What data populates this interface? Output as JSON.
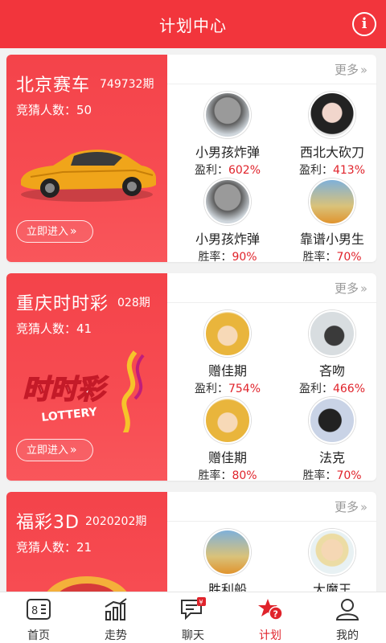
{
  "header": {
    "title": "计划中心",
    "info_symbol": "i"
  },
  "common": {
    "more_label": "更多",
    "enter_label": "立即进入"
  },
  "cards": [
    {
      "game": "北京赛车",
      "issue": "749732期",
      "guess_label": "竞猜人数：",
      "guess_count": "50",
      "users": [
        {
          "name": "小男孩炸弹",
          "stat_label": "盈利：",
          "stat_value": "602%"
        },
        {
          "name": "西北大砍刀",
          "stat_label": "盈利：",
          "stat_value": "413%"
        },
        {
          "name": "小男孩炸弹",
          "stat_label": "胜率：",
          "stat_value": "90%"
        },
        {
          "name": "靠谱小男生",
          "stat_label": "胜率：",
          "stat_value": "70%"
        }
      ]
    },
    {
      "game": "重庆时时彩",
      "issue": "028期",
      "guess_label": "竞猜人数：",
      "guess_count": "41",
      "logo_text": "时时彩",
      "logo_sub": "LOTTERY",
      "users": [
        {
          "name": "赠佳期",
          "stat_label": "盈利：",
          "stat_value": "754%"
        },
        {
          "name": "吝吻",
          "stat_label": "盈利：",
          "stat_value": "466%"
        },
        {
          "name": "赠佳期",
          "stat_label": "胜率：",
          "stat_value": "80%"
        },
        {
          "name": "法克",
          "stat_label": "胜率：",
          "stat_value": "70%"
        }
      ]
    },
    {
      "game": "福彩3D",
      "issue": "2020202期",
      "guess_label": "竞猜人数：",
      "guess_count": "21",
      "users": [
        {
          "name": "胜利船"
        },
        {
          "name": "大魔王"
        }
      ]
    }
  ],
  "nav": [
    {
      "label": "首页",
      "icon": "home-icon"
    },
    {
      "label": "走势",
      "icon": "trend-icon"
    },
    {
      "label": "聊天",
      "icon": "chat-icon",
      "badge": "¥"
    },
    {
      "label": "计划",
      "icon": "plan-icon",
      "active": true
    },
    {
      "label": "我的",
      "icon": "profile-icon"
    }
  ],
  "colors": {
    "brand_red": "#f2353c",
    "accent_red": "#e0232b"
  }
}
